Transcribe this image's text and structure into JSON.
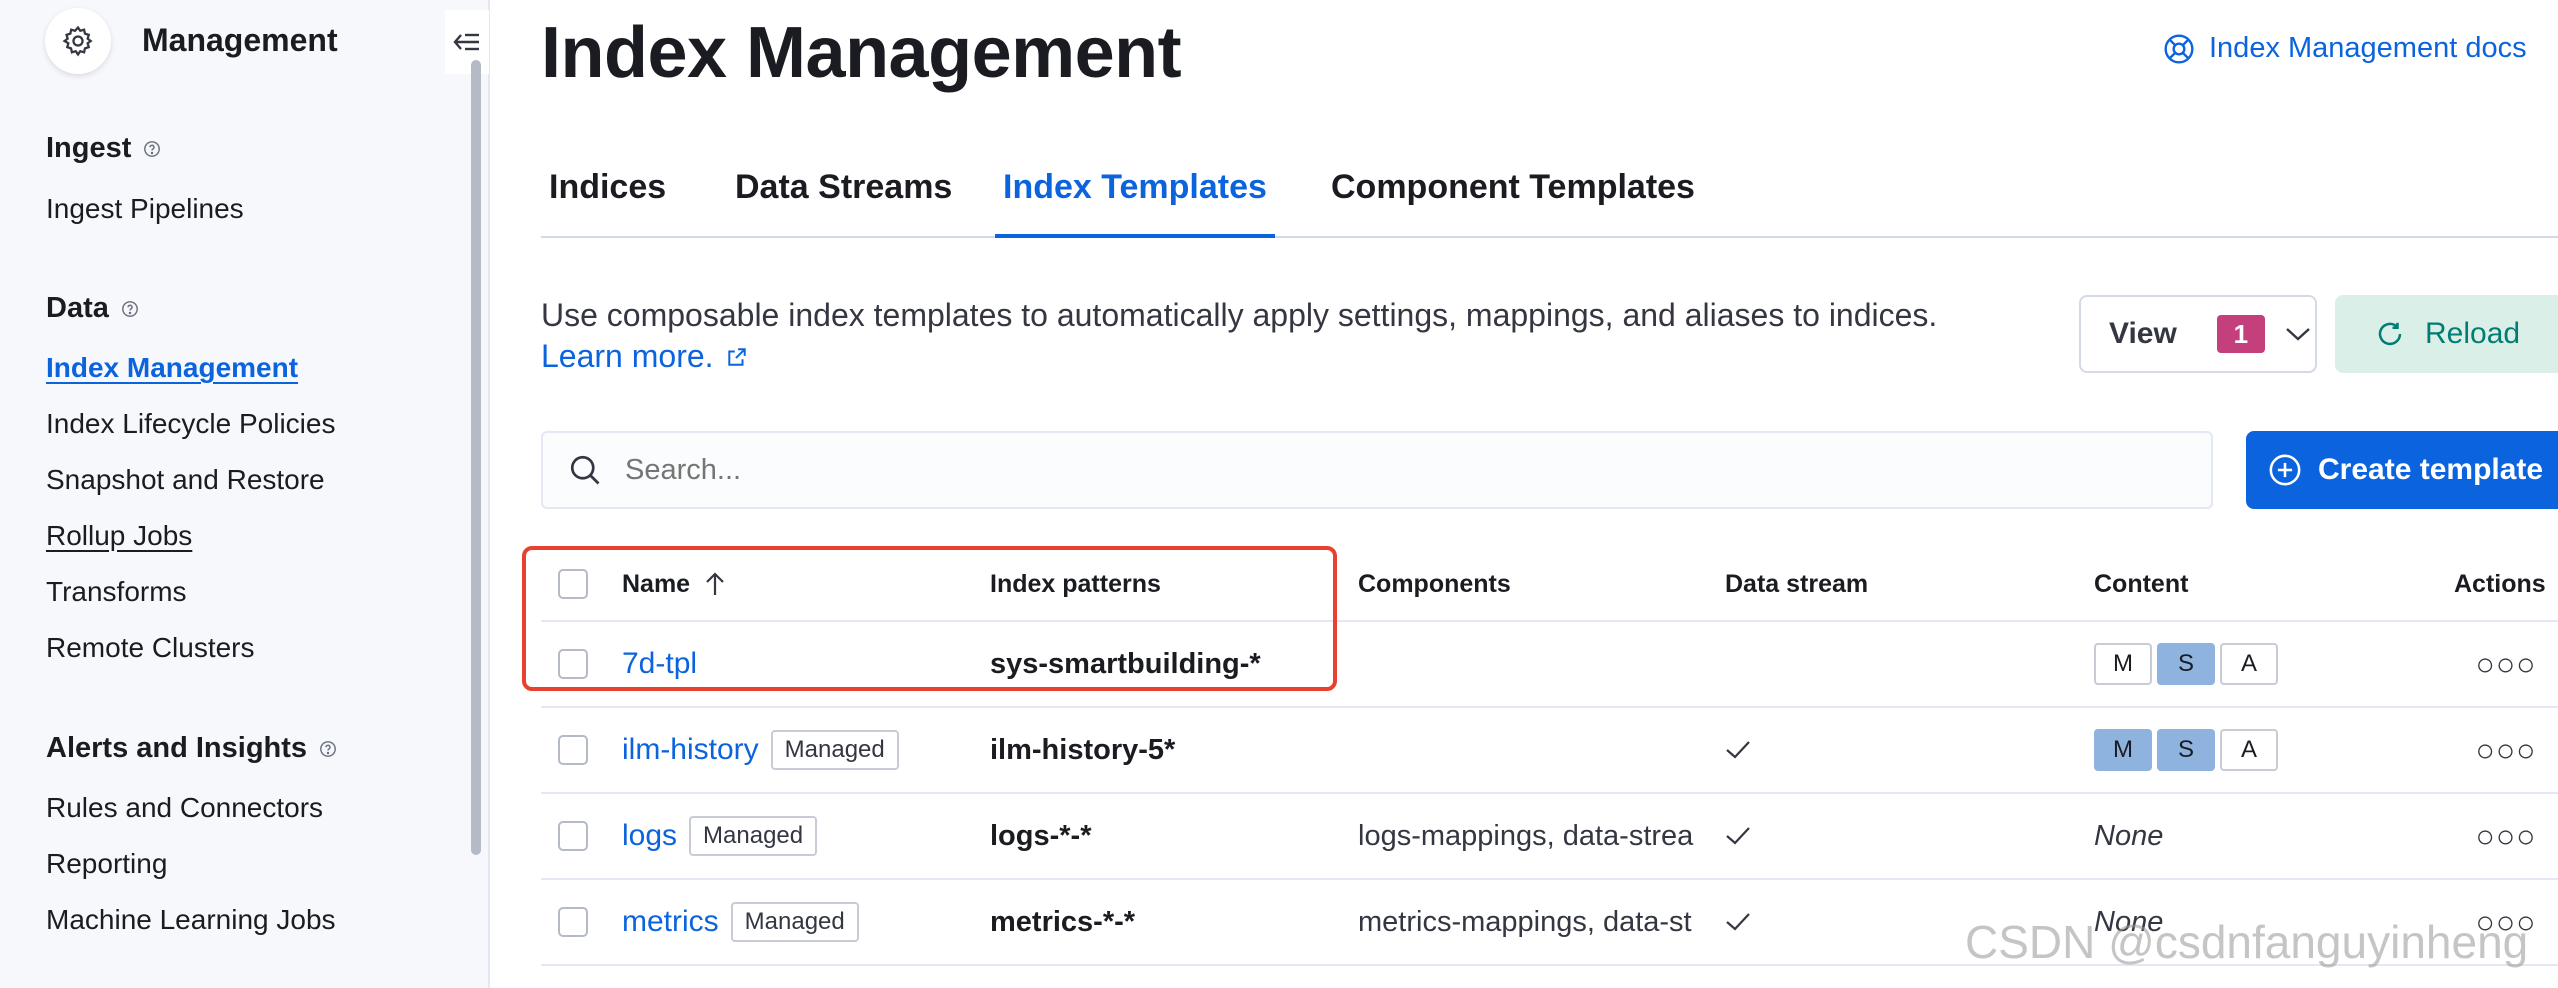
{
  "sidebar": {
    "title": "Management",
    "groups": [
      {
        "label": "Ingest",
        "items": [
          {
            "label": "Ingest Pipelines"
          }
        ]
      },
      {
        "label": "Data",
        "items": [
          {
            "label": "Index Management"
          },
          {
            "label": "Index Lifecycle Policies"
          },
          {
            "label": "Snapshot and Restore"
          },
          {
            "label": "Rollup Jobs"
          },
          {
            "label": "Transforms"
          },
          {
            "label": "Remote Clusters"
          }
        ]
      },
      {
        "label": "Alerts and Insights",
        "items": [
          {
            "label": "Rules and Connectors"
          },
          {
            "label": "Reporting"
          },
          {
            "label": "Machine Learning Jobs"
          }
        ]
      }
    ]
  },
  "header": {
    "title": "Index Management",
    "docs_link": "Index Management docs"
  },
  "tabs": [
    {
      "label": "Indices"
    },
    {
      "label": "Data Streams"
    },
    {
      "label": "Index Templates",
      "active": true
    },
    {
      "label": "Component Templates"
    }
  ],
  "description": "Use composable index templates to automatically apply settings, mappings, and aliases to indices.",
  "learn_more": "Learn more.",
  "toolbar": {
    "view_label": "View",
    "view_count": "1",
    "reload_label": "Reload",
    "create_label": "Create template"
  },
  "search": {
    "placeholder": "Search..."
  },
  "table": {
    "columns": [
      "Name",
      "Index patterns",
      "Components",
      "Data stream",
      "Content",
      "Actions"
    ],
    "rows": [
      {
        "name": "7d-tpl",
        "managed": "",
        "pattern": "sys-smartbuilding-*",
        "components": "",
        "data_stream": false,
        "content": [
          "M",
          "S",
          "A"
        ],
        "content_on": [
          false,
          true,
          false
        ],
        "content_none": ""
      },
      {
        "name": "ilm-history",
        "managed": "Managed",
        "pattern": "ilm-history-5*",
        "components": "",
        "data_stream": true,
        "content": [
          "M",
          "S",
          "A"
        ],
        "content_on": [
          true,
          true,
          false
        ],
        "content_none": ""
      },
      {
        "name": "logs",
        "managed": "Managed",
        "pattern": "logs-*-*",
        "components": "logs-mappings, data-strea",
        "data_stream": true,
        "content": [],
        "content_on": [],
        "content_none": "None"
      },
      {
        "name": "metrics",
        "managed": "Managed",
        "pattern": "metrics-*-*",
        "components": "metrics-mappings, data-st",
        "data_stream": true,
        "content": [],
        "content_on": [],
        "content_none": "None"
      }
    ]
  },
  "watermark": "CSDN @csdnfanguyinheng",
  "colors": {
    "accent": "#0b64dd",
    "highlight": "#e8412f",
    "badge": "#c4407c",
    "reload_bg": "#d9efe8"
  }
}
